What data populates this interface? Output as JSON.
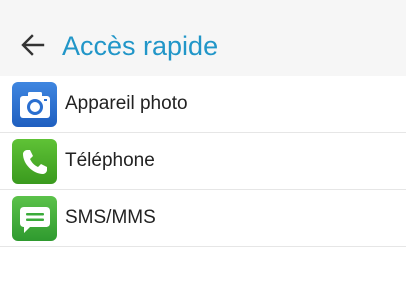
{
  "header": {
    "back_icon": "arrow-left-icon",
    "title": "Accès rapide",
    "title_color": "#2196c8"
  },
  "list": {
    "items": [
      {
        "label": "Appareil photo",
        "icon": "camera-icon",
        "icon_color": "#2a6fd0"
      },
      {
        "label": "Téléphone",
        "icon": "phone-icon",
        "icon_color": "#4caf2a"
      },
      {
        "label": "SMS/MMS",
        "icon": "message-icon",
        "icon_color": "#3bab3b"
      }
    ]
  }
}
